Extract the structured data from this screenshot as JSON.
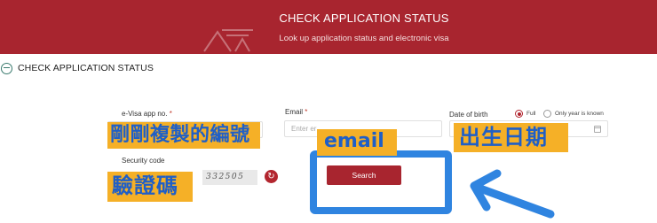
{
  "banner": {
    "title": "CHECK APPLICATION STATUS",
    "subtitle": "Look up application status and electronic visa",
    "bg_color": "#a8252f"
  },
  "section": {
    "title": "CHECK APPLICATION STATUS",
    "icon": "collapse-icon"
  },
  "form": {
    "app_no_label": "e-Visa app no.",
    "required_mark": "*",
    "email_label": "Email",
    "email_placeholder": "Enter er",
    "dob_label": "Date of birth",
    "dob_option_full": "Full",
    "dob_option_year": "Only year is known",
    "dob_selected": "Full",
    "security_label": "Security code",
    "captcha_text": "332505",
    "refresh_icon": "refresh-icon",
    "search_label": "Search"
  },
  "annotations": {
    "app_no_note": "剛剛複製的編號",
    "email_note": "email",
    "dob_note": "出生日期",
    "security_note": "驗證碼",
    "note_bg": "#f5b027",
    "note_text_color": "#1f5fc7",
    "highlight_color": "#2f84e0"
  }
}
